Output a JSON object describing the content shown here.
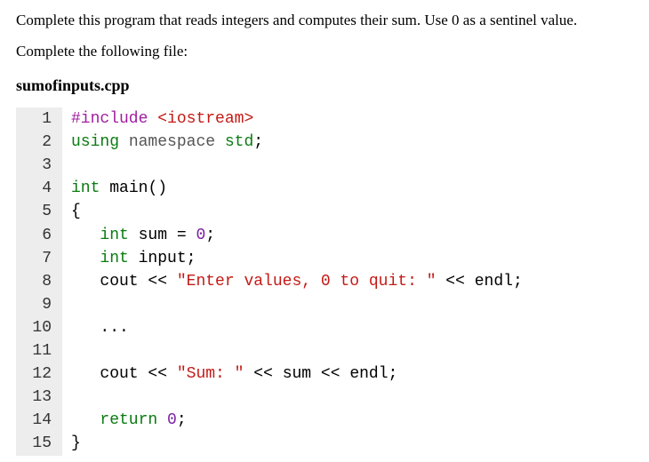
{
  "problem": {
    "statement": "Complete this program that reads integers and computes their sum. Use 0 as a sentinel value.",
    "complete_label": "Complete the following file:",
    "filename": "sumofinputs.cpp"
  },
  "code": {
    "lines": [
      {
        "n": "1",
        "tokens": [
          {
            "t": "#include",
            "c": "pre"
          },
          {
            "t": " "
          },
          {
            "t": "<iostream>",
            "c": "hdr"
          }
        ]
      },
      {
        "n": "2",
        "tokens": [
          {
            "t": "using",
            "c": "kw"
          },
          {
            "t": " "
          },
          {
            "t": "namespace",
            "c": "ns"
          },
          {
            "t": " "
          },
          {
            "t": "std",
            "c": "ty"
          },
          {
            "t": ";"
          }
        ]
      },
      {
        "n": "3",
        "tokens": []
      },
      {
        "n": "4",
        "tokens": [
          {
            "t": "int",
            "c": "kw"
          },
          {
            "t": " "
          },
          {
            "t": "main",
            "c": "fn"
          },
          {
            "t": "()"
          }
        ]
      },
      {
        "n": "5",
        "tokens": [
          {
            "t": "{"
          }
        ]
      },
      {
        "n": "6",
        "tokens": [
          {
            "t": "   "
          },
          {
            "t": "int",
            "c": "kw"
          },
          {
            "t": " "
          },
          {
            "t": "sum",
            "c": "var"
          },
          {
            "t": " = "
          },
          {
            "t": "0",
            "c": "num"
          },
          {
            "t": ";"
          }
        ]
      },
      {
        "n": "7",
        "tokens": [
          {
            "t": "   "
          },
          {
            "t": "int",
            "c": "kw"
          },
          {
            "t": " "
          },
          {
            "t": "input",
            "c": "var"
          },
          {
            "t": ";"
          }
        ]
      },
      {
        "n": "8",
        "tokens": [
          {
            "t": "   "
          },
          {
            "t": "cout",
            "c": "cout"
          },
          {
            "t": " << "
          },
          {
            "t": "\"Enter values, 0 to quit: \"",
            "c": "str"
          },
          {
            "t": " << "
          },
          {
            "t": "endl",
            "c": "endl"
          },
          {
            "t": ";"
          }
        ]
      },
      {
        "n": "9",
        "tokens": []
      },
      {
        "n": "10",
        "tokens": [
          {
            "t": "   ..."
          }
        ]
      },
      {
        "n": "11",
        "tokens": []
      },
      {
        "n": "12",
        "tokens": [
          {
            "t": "   "
          },
          {
            "t": "cout",
            "c": "cout"
          },
          {
            "t": " << "
          },
          {
            "t": "\"Sum: \"",
            "c": "str"
          },
          {
            "t": " << "
          },
          {
            "t": "sum",
            "c": "var"
          },
          {
            "t": " << "
          },
          {
            "t": "endl",
            "c": "endl"
          },
          {
            "t": ";"
          }
        ]
      },
      {
        "n": "13",
        "tokens": []
      },
      {
        "n": "14",
        "tokens": [
          {
            "t": "   "
          },
          {
            "t": "return",
            "c": "kw"
          },
          {
            "t": " "
          },
          {
            "t": "0",
            "c": "num"
          },
          {
            "t": ";"
          }
        ]
      },
      {
        "n": "15",
        "tokens": [
          {
            "t": "}"
          }
        ]
      }
    ]
  }
}
